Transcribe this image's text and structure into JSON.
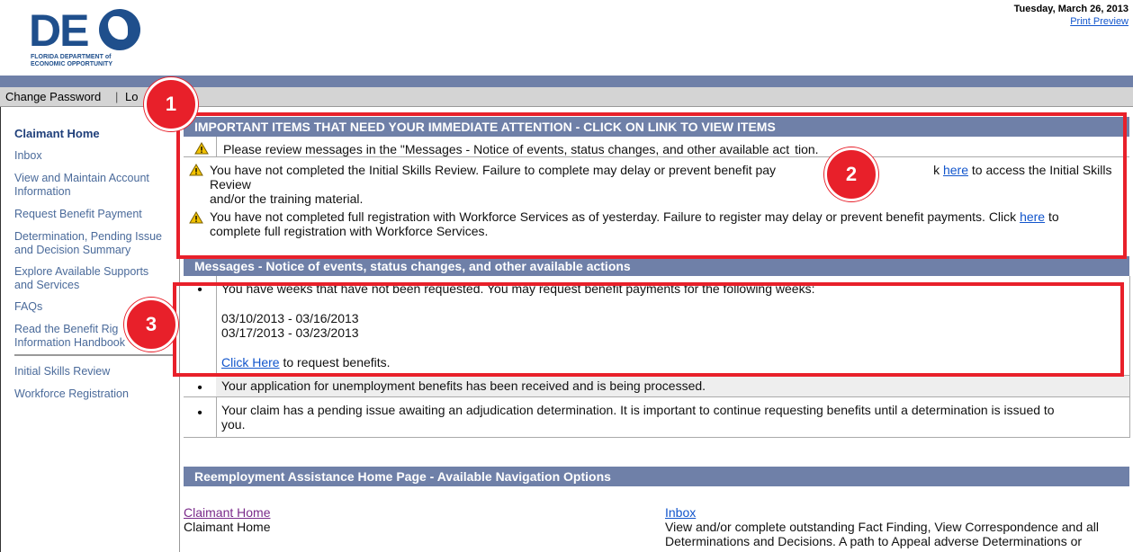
{
  "header": {
    "logo_letters": "DE",
    "logo_sub_line1": "FLORIDA DEPARTMENT of",
    "logo_sub_line2": "ECONOMIC OPPORTUNITY",
    "date": "Tuesday, March 26, 2013",
    "print_preview": "Print Preview"
  },
  "menubar": {
    "change_password": "Change Password",
    "logout": "Lo"
  },
  "sidebar": {
    "items": [
      "Claimant Home",
      "Inbox",
      "View and Maintain Account",
      "Information",
      "Request Benefit Payment",
      "Determination, Pending Issue",
      "and Decision Summary",
      "Explore Available Supports",
      "and Services",
      "FAQs",
      "Read the Benefit Rig",
      "Information Handbook",
      "Initial Skills Review",
      "Workforce Registration"
    ]
  },
  "important": {
    "title": "IMPORTANT ITEMS THAT NEED YOUR IMMEDIATE ATTENTION - CLICK ON LINK TO VIEW ITEMS",
    "item1": "Please review messages in the \"Messages - Notice of events, status changes, and other available act",
    "item1_end": "tion.",
    "item2_a": "You have not completed the Initial Skills Review. Failure to complete may delay or prevent benefit pay",
    "item2_b": "k",
    "item2_link": "here",
    "item2_c": "to access the Initial Skills Review",
    "item2_line2": "and/or the training material.",
    "item3_a": "You have not completed full registration with Workforce Services as of yesterday. Failure to register may delay or prevent benefit payments. Click",
    "item3_link": "here",
    "item3_c": "to",
    "item3_line2": "complete full registration with Workforce Services."
  },
  "messages": {
    "title": "Messages - Notice of events, status changes, and other available actions",
    "msg1": "You have weeks that have not been requested. You may request benefit payments for the following weeks:",
    "week1": "03/10/2013 - 03/16/2013",
    "week2": "03/17/2013 - 03/23/2013",
    "click_here": "Click Here",
    "click_tail": "to request benefits.",
    "msg2": "Your application for unemployment benefits has been received and is being processed.",
    "msg3_line1": "Your claim has a pending issue awaiting an adjudication determination. It is important to continue requesting benefits until a determination is issued to",
    "msg3_line2": "you."
  },
  "nav": {
    "title": "Reemployment Assistance Home Page - Available Navigation Options",
    "claimant_home_link": "Claimant Home",
    "claimant_home_desc": "Claimant Home",
    "inbox_link": "Inbox",
    "inbox_desc1": "View and/or complete outstanding Fact Finding, View Correspondence and all",
    "inbox_desc2": "Determinations and Decisions. A path to Appeal adverse Determinations or"
  },
  "badges": {
    "b1": "1",
    "b2": "2",
    "b3": "3"
  },
  "colors": {
    "accent_band": "#6f80a8",
    "callout_red": "#e8202a",
    "link_blue": "#1155cc"
  }
}
